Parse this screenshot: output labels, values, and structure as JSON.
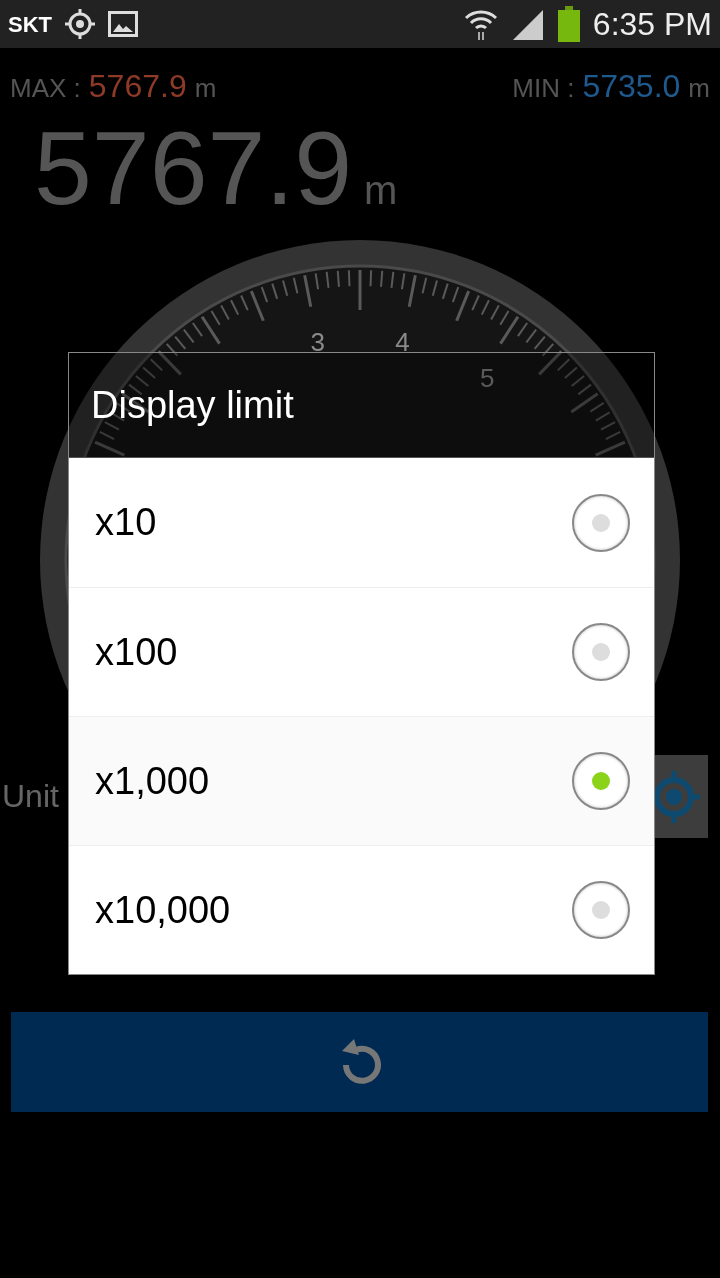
{
  "status_bar": {
    "carrier": "SKT",
    "time": "6:35 PM"
  },
  "stats": {
    "max_label": "MAX :",
    "max_value": "5767.9",
    "max_unit": "m",
    "min_label": "MIN :",
    "min_value": "5735.0",
    "min_unit": "m"
  },
  "altitude": {
    "value": "5767.9",
    "unit": "m"
  },
  "gauge": {
    "labels": [
      "3",
      "4",
      "5"
    ]
  },
  "unit_label": "Unit",
  "dialog": {
    "title": "Display limit",
    "options": [
      {
        "label": "x10",
        "selected": false
      },
      {
        "label": "x100",
        "selected": false
      },
      {
        "label": "x1,000",
        "selected": true
      },
      {
        "label": "x10,000",
        "selected": false
      }
    ]
  }
}
